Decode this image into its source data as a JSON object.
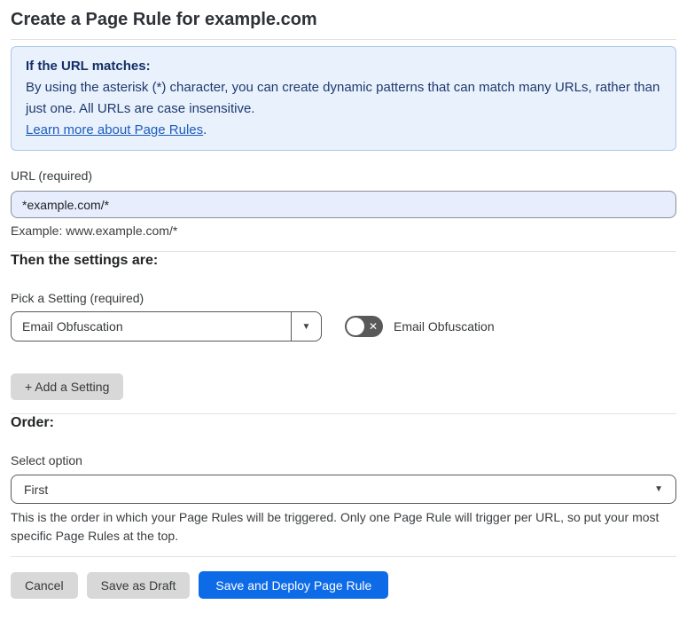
{
  "page": {
    "title": "Create a Page Rule for example.com"
  },
  "info_box": {
    "heading": "If the URL matches:",
    "body": "By using the asterisk (*) character, you can create dynamic patterns that can match many URLs, rather than just one. All URLs are case insensitive.",
    "link_label": "Learn more about Page Rules",
    "link_suffix": "."
  },
  "url_field": {
    "label": "URL (required)",
    "value": "*example.com/*",
    "helper": "Example: www.example.com/*"
  },
  "settings_section": {
    "heading": "Then the settings are:",
    "setting_label": "Pick a Setting (required)",
    "setting_value": "Email Obfuscation",
    "toggle_label": "Email Obfuscation",
    "toggle_state": "off",
    "add_setting_label": "+ Add a Setting"
  },
  "order_section": {
    "heading": "Order:",
    "select_label": "Select option",
    "select_value": "First",
    "helper": "This is the order in which your Page Rules will be triggered. Only one Page Rule will trigger per URL, so put your most specific Page Rules at the top."
  },
  "footer": {
    "cancel_label": "Cancel",
    "save_draft_label": "Save as Draft",
    "save_deploy_label": "Save and Deploy Page Rule"
  },
  "icons": {
    "dropdown_arrow_icon": "▼",
    "select_chevron_icon": "▼",
    "toggle_off_icon": "✕"
  },
  "colors": {
    "info_box_bg": "#e9f1fc",
    "info_box_border": "#abc9ec",
    "info_text": "#1e3a6e",
    "link_blue": "#1d5dbf",
    "url_input_bg": "#e7edfc",
    "toggle_off_bg": "#595959",
    "gray_button_bg": "#d8d8d8",
    "primary_button_bg": "#0e6be8"
  }
}
